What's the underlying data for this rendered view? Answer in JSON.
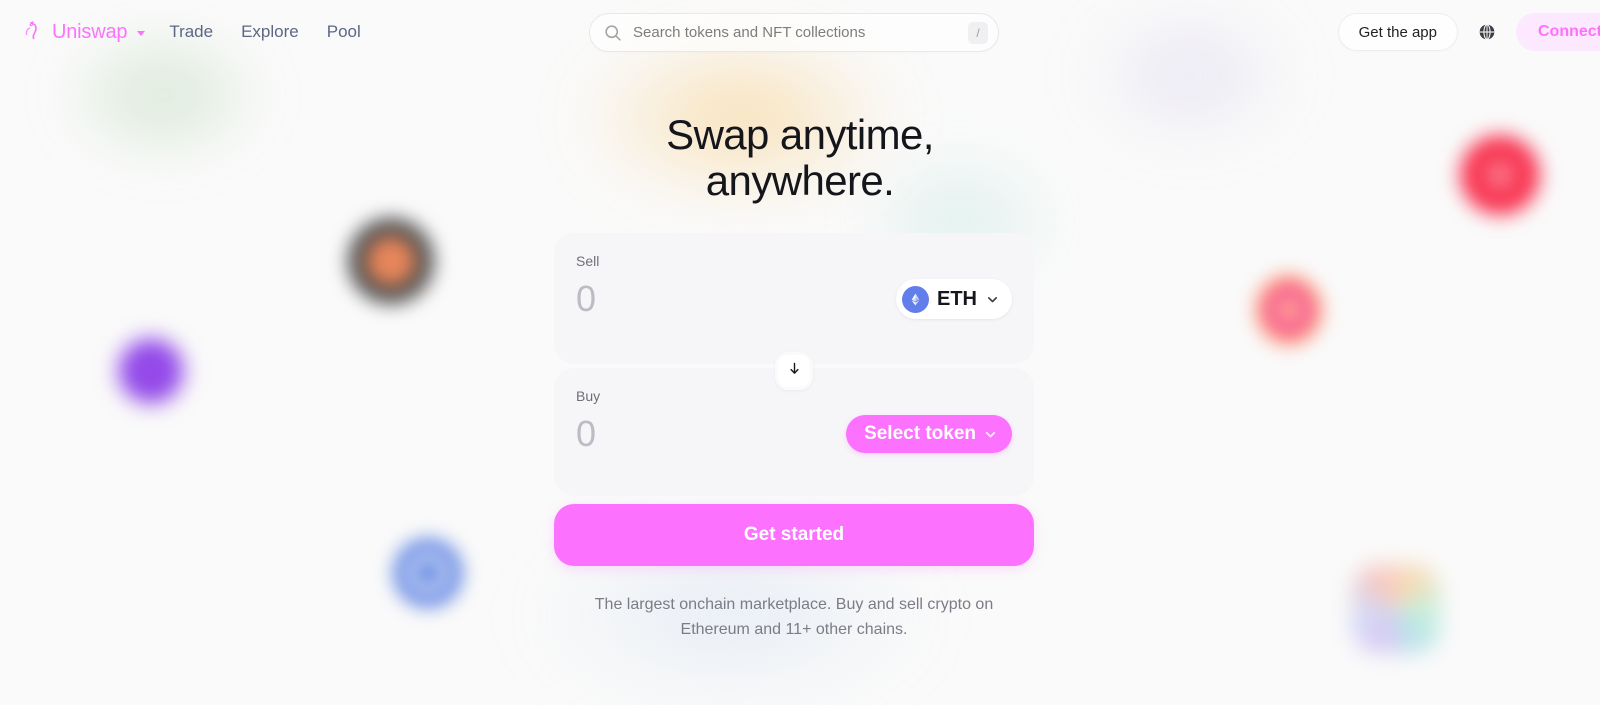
{
  "header": {
    "brand": {
      "name": "Uniswap",
      "icon": "unicorn-logo-icon",
      "caret": "chevron-down-icon",
      "color": "#FC72FF"
    },
    "nav": [
      {
        "label": "Trade"
      },
      {
        "label": "Explore"
      },
      {
        "label": "Pool"
      }
    ],
    "search": {
      "icon": "search-icon",
      "placeholder": "Search tokens and NFT collections",
      "value": "",
      "shortcut": "/"
    },
    "actions": {
      "get_app_label": "Get the app",
      "globe_icon": "globe-icon",
      "connect_label": "Connect",
      "connect_bg": "#FCE9FF",
      "connect_color": "#FC72FF"
    }
  },
  "hero": {
    "title_line1": "Swap anytime,",
    "title_line2": "anywhere."
  },
  "swap": {
    "sell": {
      "label": "Sell",
      "amount": "0",
      "token": {
        "symbol": "ETH",
        "icon": "ethereum-icon",
        "icon_bg": "#627EEA",
        "chevron": "chevron-down-icon"
      }
    },
    "swap_direction_icon": "arrow-down-icon",
    "buy": {
      "label": "Buy",
      "amount": "0",
      "select_token_label": "Select token",
      "select_token_chevron": "chevron-down-icon",
      "select_token_bg": "#FC72FF"
    },
    "cta": {
      "label": "Get started",
      "bg": "#FC72FF",
      "color": "#FFFFFF"
    }
  },
  "footer": {
    "subtitle_line1": "The largest onchain marketplace. Buy and sell crypto on",
    "subtitle_line2": "Ethereum and 11+ other chains."
  },
  "decorations": [
    {
      "name": "green-glow",
      "color": "#82B978"
    },
    {
      "name": "amber-glow",
      "color": "#F7BE5A"
    },
    {
      "name": "teal-glow",
      "color": "#96D7CD"
    },
    {
      "name": "lavender-glow",
      "color": "#C3B9E1"
    },
    {
      "name": "dark-orange-token-blob",
      "color": "#E8865A"
    },
    {
      "name": "purple-token-blob",
      "color": "#9A4DEA"
    },
    {
      "name": "blue-ring-token-blob",
      "color": "#5A7FE0"
    },
    {
      "name": "red-token-blob",
      "color": "#F8304E"
    },
    {
      "name": "sunset-token-blob",
      "color": "#F0459B"
    },
    {
      "name": "rainbow-token-blob",
      "color": "#C9A8F0"
    }
  ]
}
